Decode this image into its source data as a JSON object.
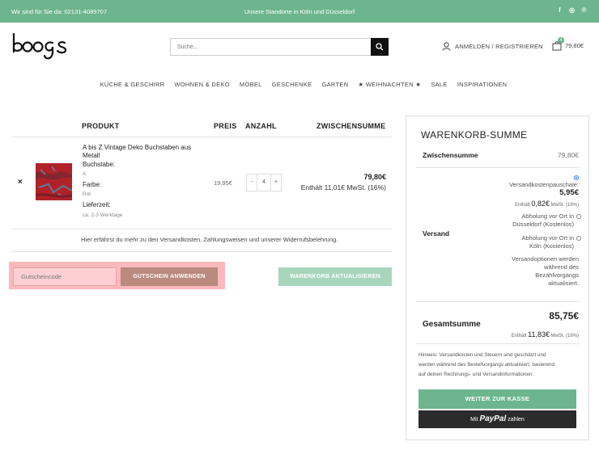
{
  "topbar": {
    "phone": "Wir sind für Sie da: 02131-4089707",
    "locations": "Unsere Standorte in Köln und Düsseldorf",
    "social": [
      "f",
      "◎",
      "℗"
    ]
  },
  "header": {
    "logo": "boogs",
    "search_placeholder": "Suche...",
    "account_label": "ANMELDEN / REGISTRIEREN",
    "cart_count": "4",
    "cart_total": "79,80€"
  },
  "nav": {
    "items": [
      "KÜCHE & GESCHIRR",
      "WOHNEN & DEKO",
      "MÖBEL",
      "GESCHENKE",
      "GARTEN",
      "★ WEIHNACHTEN ★",
      "SALE",
      "INSPIRATIONEN"
    ]
  },
  "cart": {
    "headers": {
      "product": "PRODUKT",
      "price": "PREIS",
      "qty": "ANZAHL",
      "subtotal": "ZWISCHENSUMME"
    },
    "item": {
      "remove": "×",
      "name": "A bis Z Vintage Deko Buchstaben aus Metall",
      "letter_label": "Buchstabe:",
      "letter_value": "A",
      "color_label": "Farbe:",
      "color_value": "Rot",
      "delivery_label": "Lieferzeit:",
      "delivery_value": "ca. 2-3 Werktage",
      "price": "19,95€",
      "qty_minus": "-",
      "qty_value": "4",
      "qty_plus": "+",
      "subtotal": "79,80€",
      "subtotal_tax": "Enthält 11,01€ MwSt. (16%)"
    },
    "info_text": {
      "prefix": "Hier erfährst du mehr zu den ",
      "shipping": "Versandkosten",
      "sep1": ", ",
      "payment": "Zahlungsweisen",
      "sep2": " und unserer ",
      "withdrawal": "Widerrufsbelehrung",
      "suffix": "."
    },
    "coupon_placeholder": "Gutscheincode",
    "coupon_button": "GUTSCHEIN ANWENDEN",
    "update_button": "WARENKORB AKTUALISIEREN"
  },
  "totals": {
    "title": "WARENKORB-SUMME",
    "subtotal_label": "Zwischensumme",
    "subtotal_value": "79,80€",
    "shipping_label": "Versand",
    "shipping_option1": "Versandkostenpauschale:",
    "shipping_option1_price": "5,95€",
    "shipping_option1_tax_prefix": "Enthält ",
    "shipping_option1_tax_value": "0,82€",
    "shipping_option1_tax_suffix": " MwSt. (16%)",
    "shipping_option2_line1": "Abholung vor Ort in",
    "shipping_option2_line2": "Düsseldorf (Kostenlos)",
    "shipping_option3_line1": "Abholung vor Ort in",
    "shipping_option3_line2": "Köln (Kostenlos)",
    "shipping_note_lines": [
      "Versandoptionen werden",
      "während des",
      "Bezahlvorgangs",
      "aktualisiert."
    ],
    "total_label": "Gesamtsumme",
    "total_value": "85,75€",
    "total_tax_prefix": "Enthält ",
    "total_tax_value": "11,83€",
    "total_tax_suffix": " MwSt. (16%)",
    "note_lines": [
      "Hinweis: Versandkosten und Steuern sind geschätzt und",
      "werden während des Bestellvorgangs aktualisiert, basierend",
      "auf deinen Rechnungs- und Versandinformationen."
    ],
    "checkout_button": "WEITER ZUR KASSE",
    "paypal_prefix": "Mit ",
    "paypal_brand": "PayPal",
    "paypal_suffix": " zahlen"
  },
  "colors": {
    "brand_green": "#6db58e",
    "coupon_highlight": "#fbb8bd",
    "coupon_button": "#b98a7d",
    "update_button": "#a8d6bc"
  }
}
